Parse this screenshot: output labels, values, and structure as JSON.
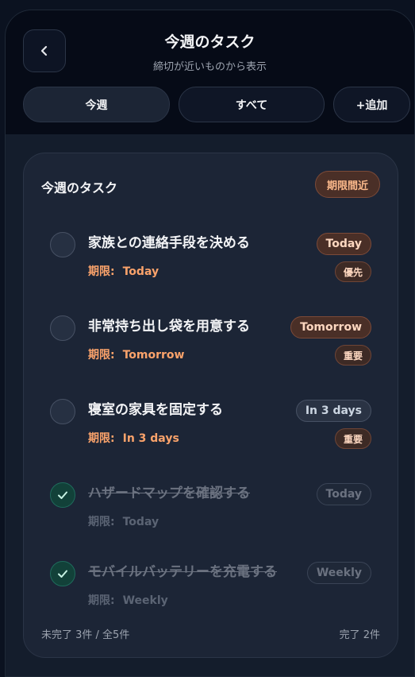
{
  "header": {
    "title": "今週のタスク",
    "subtitle": "締切が近いものから表示"
  },
  "tabs": [
    {
      "label": "今週"
    },
    {
      "label": "すべて"
    },
    {
      "label": "+追加"
    }
  ],
  "card": {
    "title": "今週のタスク",
    "badge": "期限間近",
    "due_label": "期限:",
    "tasks": [
      {
        "name": "家族との連絡手段を決める",
        "due": "Today",
        "date_pill": "Today",
        "tag": "優先",
        "done": false
      },
      {
        "name": "非常持ち出し袋を用意する",
        "due": "Tomorrow",
        "date_pill": "Tomorrow",
        "tag": "重要",
        "done": false
      },
      {
        "name": "寝室の家具を固定する",
        "due": "In 3 days",
        "date_pill": "In 3 days",
        "tag": "重要",
        "done": false
      },
      {
        "name": "ハザードマップを確認する",
        "due": "Today",
        "date_pill": "Today",
        "tag": "",
        "done": true
      },
      {
        "name": "モバイルバッテリーを充電する",
        "due": "Weekly",
        "date_pill": "Weekly",
        "tag": "",
        "done": true
      }
    ],
    "footer_left": "未完了 3件 / 全5件",
    "footer_right": "完了 2件"
  },
  "colors": {
    "accent_orange": "#fba36b",
    "done_green": "#124139",
    "background": "#141d2c"
  }
}
